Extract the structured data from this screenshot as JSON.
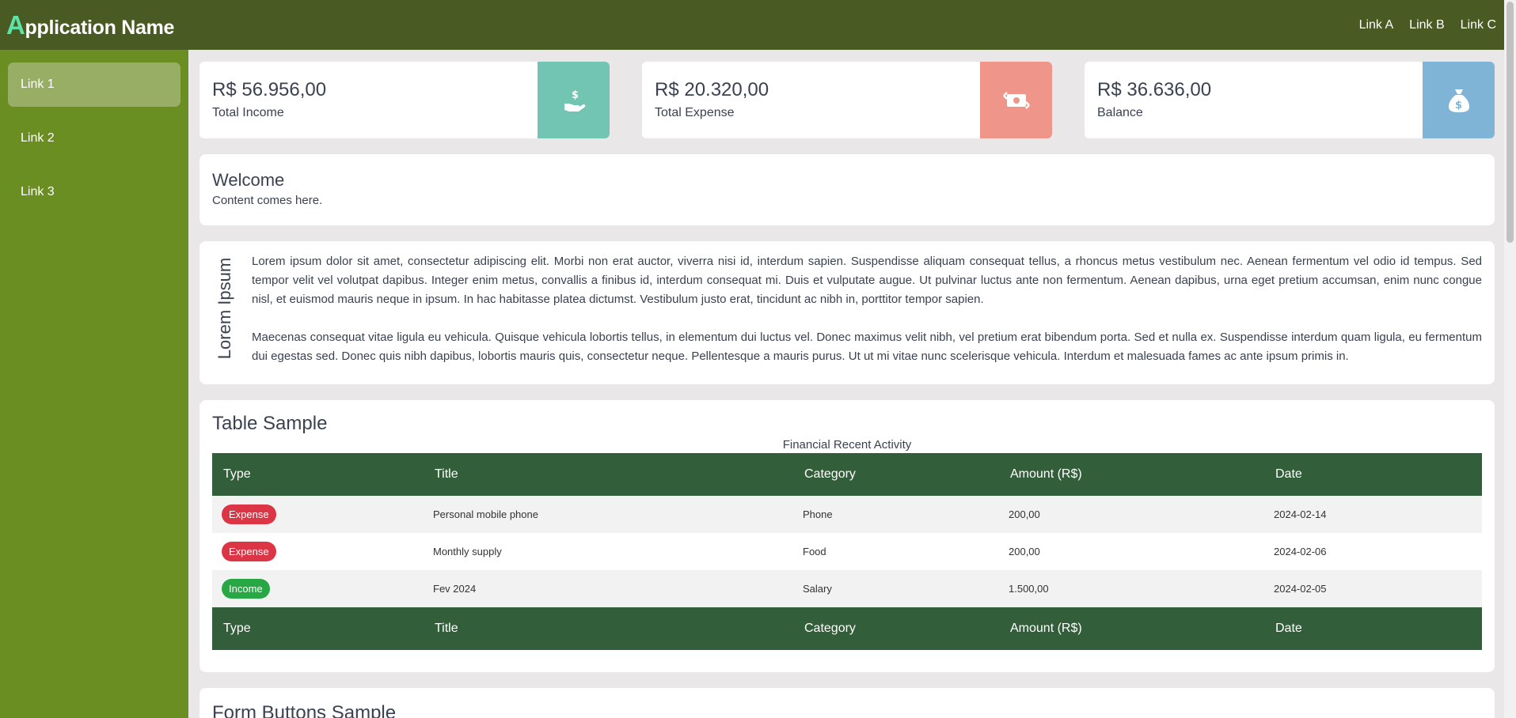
{
  "header": {
    "brand_initial": "A",
    "brand_rest": "pplication Name",
    "links": [
      "Link A",
      "Link B",
      "Link C"
    ]
  },
  "sidebar": {
    "items": [
      {
        "label": "Link 1",
        "active": true
      },
      {
        "label": "Link 2",
        "active": false
      },
      {
        "label": "Link 3",
        "active": false
      }
    ]
  },
  "cards": [
    {
      "value": "R$ 56.956,00",
      "label": "Total Income",
      "icon": "hand-dollar-icon",
      "color": "#72c4b3"
    },
    {
      "value": "R$ 20.320,00",
      "label": "Total Expense",
      "icon": "money-exchange-icon",
      "color": "#f0958a"
    },
    {
      "value": "R$ 36.636,00",
      "label": "Balance",
      "icon": "money-bag-icon",
      "color": "#80b4d7"
    }
  ],
  "welcome": {
    "title": "Welcome",
    "text": "Content comes here."
  },
  "lorem": {
    "side_title": "Lorem Ipsum",
    "p1": "Lorem ipsum dolor sit amet, consectetur adipiscing elit. Morbi non erat auctor, viverra nisi id, interdum sapien. Suspendisse aliquam consequat tellus, a rhoncus metus vestibulum nec. Aenean fermentum vel odio id tempus. Sed tempor velit vel volutpat dapibus. Integer enim metus, convallis a finibus id, interdum consequat mi. Duis et vulputate augue. Ut pulvinar luctus ante non fermentum. Aenean dapibus, urna eget pretium accumsan, enim nunc congue nisl, et euismod mauris neque in ipsum. In hac habitasse platea dictumst. Vestibulum justo erat, tincidunt ac nibh in, porttitor tempor sapien.",
    "p2": "Maecenas consequat vitae ligula eu vehicula. Quisque vehicula lobortis tellus, in elementum dui luctus vel. Donec maximus velit nibh, vel pretium erat bibendum porta. Sed et nulla ex. Suspendisse interdum quam ligula, eu fermentum dui egestas sed. Donec quis nibh dapibus, lobortis mauris quis, consectetur neque. Pellentesque a mauris purus. Ut ut mi vitae nunc scelerisque vehicula. Interdum et malesuada fames ac ante ipsum primis in."
  },
  "table": {
    "title": "Table Sample",
    "caption": "Financial Recent Activity",
    "columns": [
      "Type",
      "Title",
      "Category",
      "Amount (R$)",
      "Date"
    ],
    "rows": [
      {
        "type": "Expense",
        "type_color": "#dc3545",
        "title": "Personal mobile phone",
        "category": "Phone",
        "amount": "200,00",
        "date": "2024-02-14"
      },
      {
        "type": "Expense",
        "type_color": "#dc3545",
        "title": "Monthly supply",
        "category": "Food",
        "amount": "200,00",
        "date": "2024-02-06"
      },
      {
        "type": "Income",
        "type_color": "#28a745",
        "title": "Fev 2024",
        "category": "Salary",
        "amount": "1.500,00",
        "date": "2024-02-05"
      }
    ]
  },
  "form": {
    "title": "Form Buttons Sample"
  }
}
